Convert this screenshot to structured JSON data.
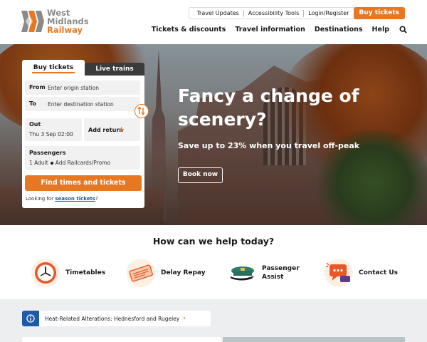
{
  "brand": {
    "line1": "West",
    "line2": "Midlands",
    "line3": "Railway",
    "accent_color": "#e87722",
    "grey_color": "#8a8a8a"
  },
  "utility_nav": {
    "items": [
      "Travel Updates",
      "Accessibility Tools",
      "Login/Register"
    ],
    "buy_label": "Buy tickets"
  },
  "main_nav": {
    "items": [
      "Tickets & discounts",
      "Travel information",
      "Destinations",
      "Help"
    ],
    "search_icon": "search-icon"
  },
  "hero": {
    "title": "Fancy a change of scenery?",
    "subtitle": "Save up to 23% when you travel off-peak",
    "cta": "Book now"
  },
  "booking": {
    "tabs": [
      "Buy tickets",
      "Live trains"
    ],
    "from_label": "From",
    "from_placeholder": "Enter origin station",
    "to_label": "To",
    "to_placeholder": "Enter destination station",
    "out_label": "Out",
    "out_value": "Thu 3 Sep 02:00",
    "return_label": "Add return",
    "passengers_label": "Passengers",
    "passengers_value": "1 Adult",
    "railcards_label": "Add Railcards/Promo",
    "find_label": "Find times and tickets",
    "looking_prefix": "Looking for",
    "looking_link": "season tickets",
    "looking_suffix": "?"
  },
  "help": {
    "title": "How can we help today?",
    "items": [
      {
        "label": "Timetables",
        "icon": "clock-icon"
      },
      {
        "label": "Delay Repay",
        "icon": "ticket-icon"
      },
      {
        "label": "Passenger Assist",
        "icon": "conductor-cap-icon"
      },
      {
        "label": "Contact Us",
        "icon": "chat-bubble-icon"
      }
    ]
  },
  "alert": {
    "text": "Heat-Related Alterations: Hednesford and Rugeley",
    "chevron": "›"
  }
}
